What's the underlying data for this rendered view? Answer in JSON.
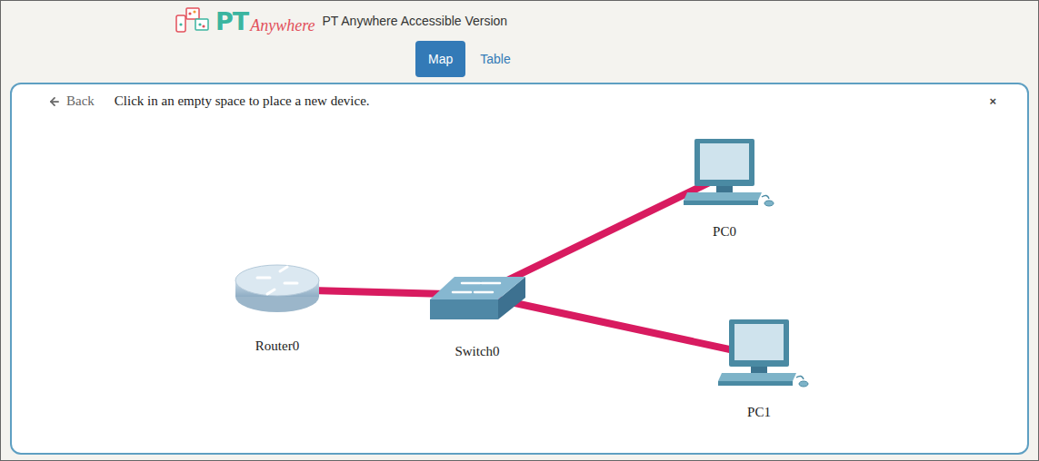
{
  "header": {
    "logo": {
      "mark": "PT",
      "script": "Anywhere"
    },
    "title": "PT Anywhere Accessible Version"
  },
  "tabs": [
    {
      "label": "Map",
      "selected": true
    },
    {
      "label": "Table",
      "selected": false
    }
  ],
  "panel": {
    "back": "Back",
    "instruction": "Click in an empty space to place a new device.",
    "close": "×"
  },
  "devices": [
    {
      "name": "Router0",
      "kind": "router"
    },
    {
      "name": "Switch0",
      "kind": "switch"
    },
    {
      "name": "PC0",
      "kind": "pc"
    },
    {
      "name": "PC1",
      "kind": "pc"
    }
  ],
  "links": [
    {
      "from": "Router0",
      "to": "Switch0"
    },
    {
      "from": "Switch0",
      "to": "PC0"
    },
    {
      "from": "Switch0",
      "to": "PC1"
    }
  ]
}
